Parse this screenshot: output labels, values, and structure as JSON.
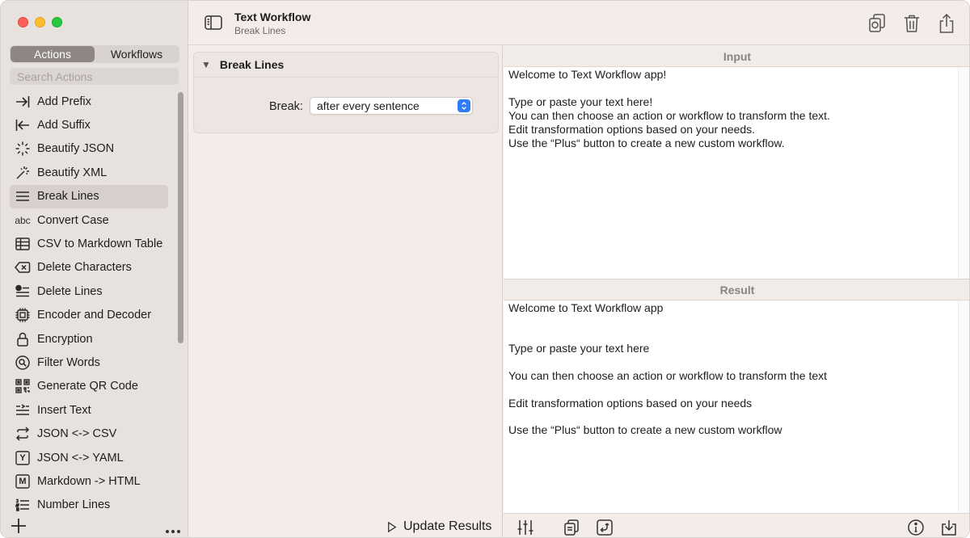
{
  "window": {
    "title": "Text Workflow",
    "subtitle": "Break Lines"
  },
  "sidebar": {
    "tabs": [
      {
        "label": "Actions",
        "active": true
      },
      {
        "label": "Workflows",
        "active": false
      }
    ],
    "search_placeholder": "Search Actions",
    "items": [
      {
        "label": "Add Prefix",
        "icon": "arrow-right-bar-icon"
      },
      {
        "label": "Add Suffix",
        "icon": "arrow-left-bar-icon"
      },
      {
        "label": "Beautify JSON",
        "icon": "sparkle-icon"
      },
      {
        "label": "Beautify XML",
        "icon": "magic-wand-icon"
      },
      {
        "label": "Break Lines",
        "icon": "lines-icon",
        "selected": true
      },
      {
        "label": "Convert Case",
        "icon": "abc-icon",
        "glyph": "abc"
      },
      {
        "label": "CSV to Markdown Table",
        "icon": "table-icon"
      },
      {
        "label": "Delete Characters",
        "icon": "delete-left-icon"
      },
      {
        "label": "Delete Lines",
        "icon": "delete-lines-icon"
      },
      {
        "label": "Encoder and Decoder",
        "icon": "cpu-icon"
      },
      {
        "label": "Encryption",
        "icon": "lock-icon"
      },
      {
        "label": "Filter Words",
        "icon": "magnifier-icon"
      },
      {
        "label": "Generate QR Code",
        "icon": "qrcode-icon"
      },
      {
        "label": "Insert Text",
        "icon": "insert-text-icon"
      },
      {
        "label": "JSON <-> CSV",
        "icon": "repeat-icon"
      },
      {
        "label": "JSON <-> YAML",
        "icon": "y-square-icon",
        "glyph": "Y"
      },
      {
        "label": "Markdown -> HTML",
        "icon": "m-square-icon",
        "glyph": "M"
      },
      {
        "label": "Number Lines",
        "icon": "numbered-list-icon"
      }
    ]
  },
  "action_card": {
    "title": "Break Lines",
    "break_label": "Break:",
    "break_value": "after every sentence"
  },
  "update_label": "Update Results",
  "input": {
    "header": "Input",
    "text": "Welcome to Text Workflow app!\n\nType or paste your text here!\nYou can then choose an action or workflow to transform the text.\nEdit transformation options based on your needs.\nUse the “Plus“ button to create a new custom workflow."
  },
  "result": {
    "header": "Result",
    "text": "Welcome to Text Workflow app\n\n\nType or paste your text here\n\nYou can then choose an action or workflow to transform the text\n\nEdit transformation options based on your needs\n\nUse the “Plus“ button to create a new custom workflow"
  },
  "colors": {
    "accent": "#2f7cf6",
    "segment_active": "#8d8683",
    "sidebar_bg": "#e8e2df",
    "window_bg": "#f3ece8"
  }
}
